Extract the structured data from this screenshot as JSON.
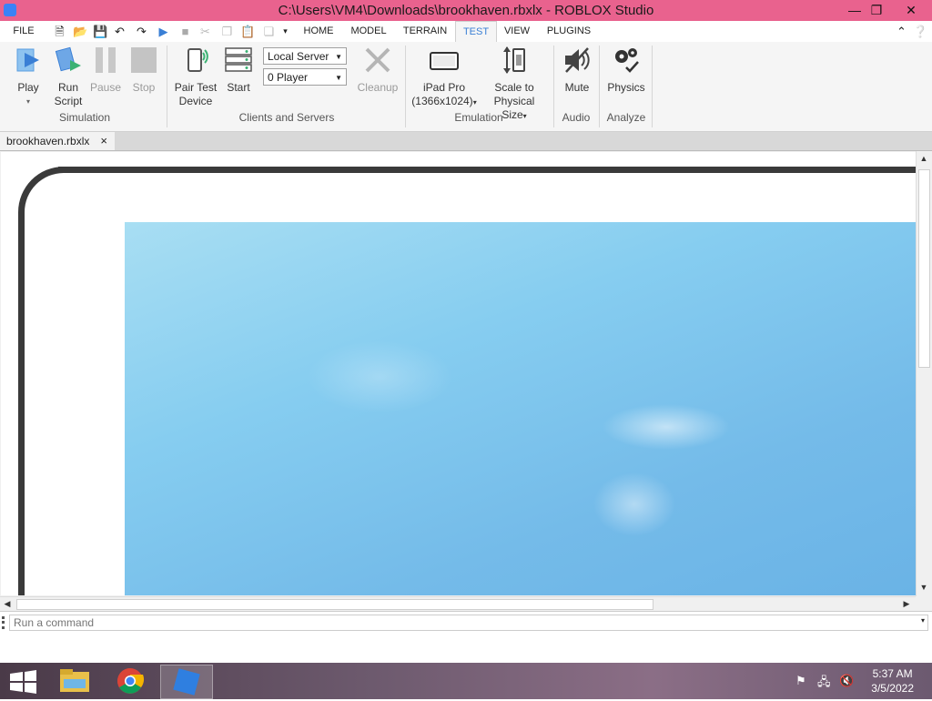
{
  "window": {
    "title": "C:\\Users\\VM4\\Downloads\\brookhaven.rbxlx - ROBLOX Studio",
    "min": "—",
    "restore": "❐",
    "close": "✕"
  },
  "menu": {
    "file": "FILE",
    "tabs": [
      "HOME",
      "MODEL",
      "TERRAIN",
      "TEST",
      "VIEW",
      "PLUGINS"
    ],
    "active_tab": "TEST"
  },
  "ribbon": {
    "simulation": {
      "play": "Play",
      "run_script_1": "Run",
      "run_script_2": "Script",
      "pause": "Pause",
      "stop": "Stop",
      "group_label": "Simulation"
    },
    "clients": {
      "pair_1": "Pair Test",
      "pair_2": "Device",
      "start": "Start",
      "server_select": "Local Server",
      "player_select": "0 Player",
      "cleanup": "Cleanup",
      "group_label": "Clients and Servers"
    },
    "emulation": {
      "device_1": "iPad Pro",
      "device_2": "(1366x1024)",
      "scale_1": "Scale to",
      "scale_2": "Physical Size",
      "group_label": "Emulation"
    },
    "audio": {
      "mute": "Mute",
      "group_label": "Audio"
    },
    "analyze": {
      "physics": "Physics",
      "group_label": "Analyze"
    }
  },
  "doc_tab": {
    "label": "brookhaven.rbxlx",
    "close": "×"
  },
  "command_bar": {
    "placeholder": "Run a command"
  },
  "taskbar": {
    "time": "5:37 AM",
    "date": "3/5/2022"
  },
  "colors": {
    "titlebar": "#e9628e",
    "accent": "#3a7fd5",
    "sky": "#86cdf0"
  }
}
